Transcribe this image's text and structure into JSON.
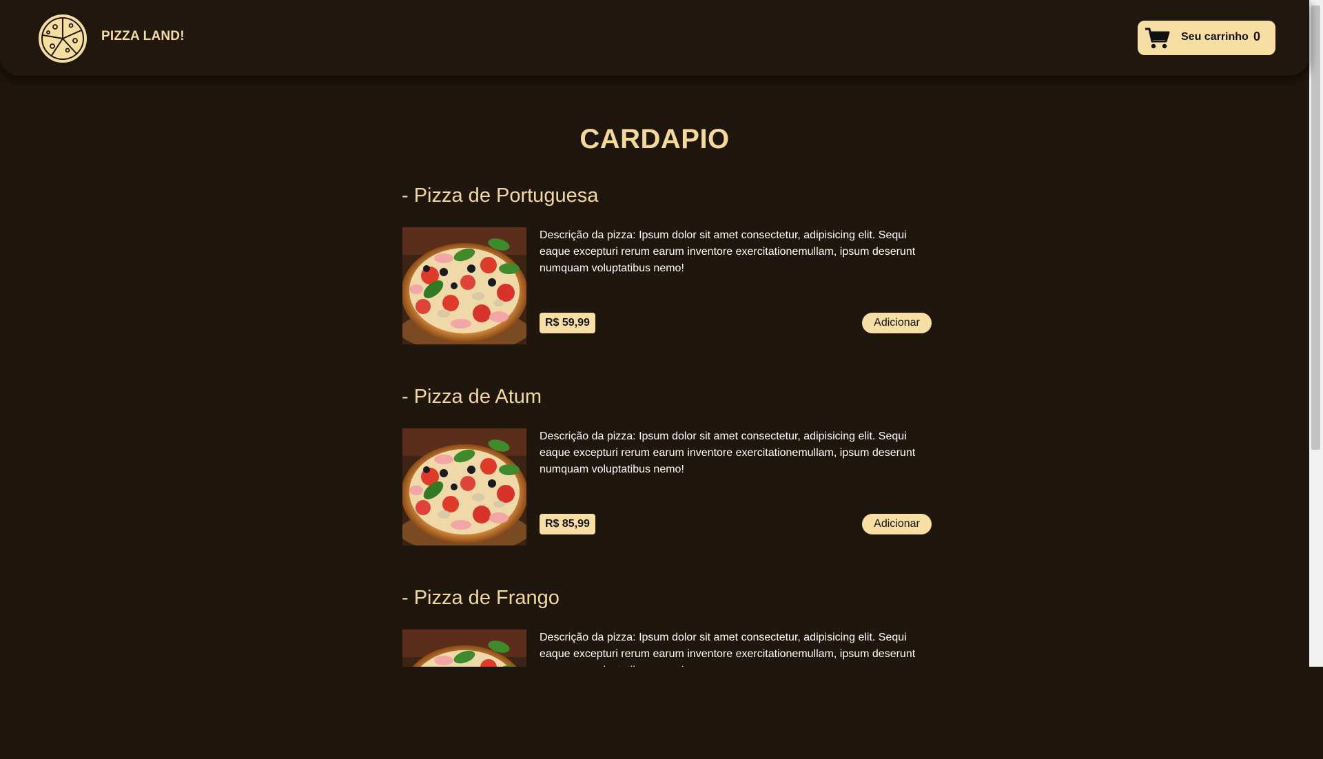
{
  "header": {
    "brand": "PIZZA LAND!",
    "logo_icon": "pizza-logo-icon",
    "cart": {
      "icon": "shopping-cart-icon",
      "label": "Seu carrinho",
      "count": "0"
    }
  },
  "main": {
    "title": "CARDAPIO",
    "items": [
      {
        "name": "- Pizza de Portuguesa",
        "description": "Descrição da pizza: Ipsum dolor sit amet consectetur, adipisicing elit. Sequi eaque excepturi rerum earum inventore exercitationemullam, ipsum deserunt numquam voluptatibus nemo!",
        "price": "R$ 59,99",
        "add_label": "Adicionar"
      },
      {
        "name": "- Pizza de Atum",
        "description": "Descrição da pizza: Ipsum dolor sit amet consectetur, adipisicing elit. Sequi eaque excepturi rerum earum inventore exercitationemullam, ipsum deserunt numquam voluptatibus nemo!",
        "price": "R$ 85,99",
        "add_label": "Adicionar"
      },
      {
        "name": "- Pizza de Frango",
        "description": "Descrição da pizza: Ipsum dolor sit amet consectetur, adipisicing elit. Sequi eaque excepturi rerum earum inventore exercitationemullam, ipsum deserunt numquam voluptatibus nemo!",
        "price": "",
        "add_label": ""
      }
    ]
  },
  "colors": {
    "background": "#1f160d",
    "accent": "#f7dfa3",
    "heading": "#f5d99a"
  }
}
